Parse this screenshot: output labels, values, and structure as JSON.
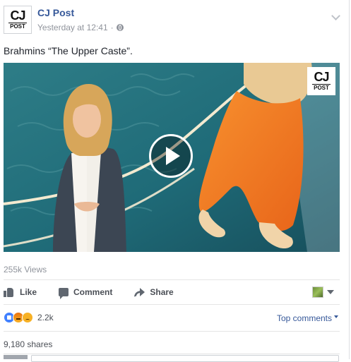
{
  "post": {
    "page_name": "CJ Post",
    "timestamp": "Yesterday at 12:41",
    "separator": "·",
    "privacy_icon": "globe-icon",
    "menu_icon": "chevron-down-icon",
    "text": "Brahmins “The Upper Caste”."
  },
  "avatar": {
    "logo_big": "CJ",
    "logo_small": "POST"
  },
  "video": {
    "logo_big": "CJ",
    "logo_small": "POST",
    "play_icon": "play-icon",
    "views": "255k Views"
  },
  "actions": {
    "like_label": "Like",
    "comment_label": "Comment",
    "share_label": "Share",
    "profile_icon": "profile-thumb-icon"
  },
  "reactions": {
    "icons": [
      "like",
      "angry",
      "sad"
    ],
    "count": "2.2k",
    "sort_label": "Top comments"
  },
  "shares": {
    "label": "9,180 shares"
  },
  "colors": {
    "link_blue": "#365899",
    "meta_grey": "#90949c",
    "action_grey": "#4b4f56",
    "video_teal": "#1f6b78",
    "robe_orange": "#f47a20"
  }
}
